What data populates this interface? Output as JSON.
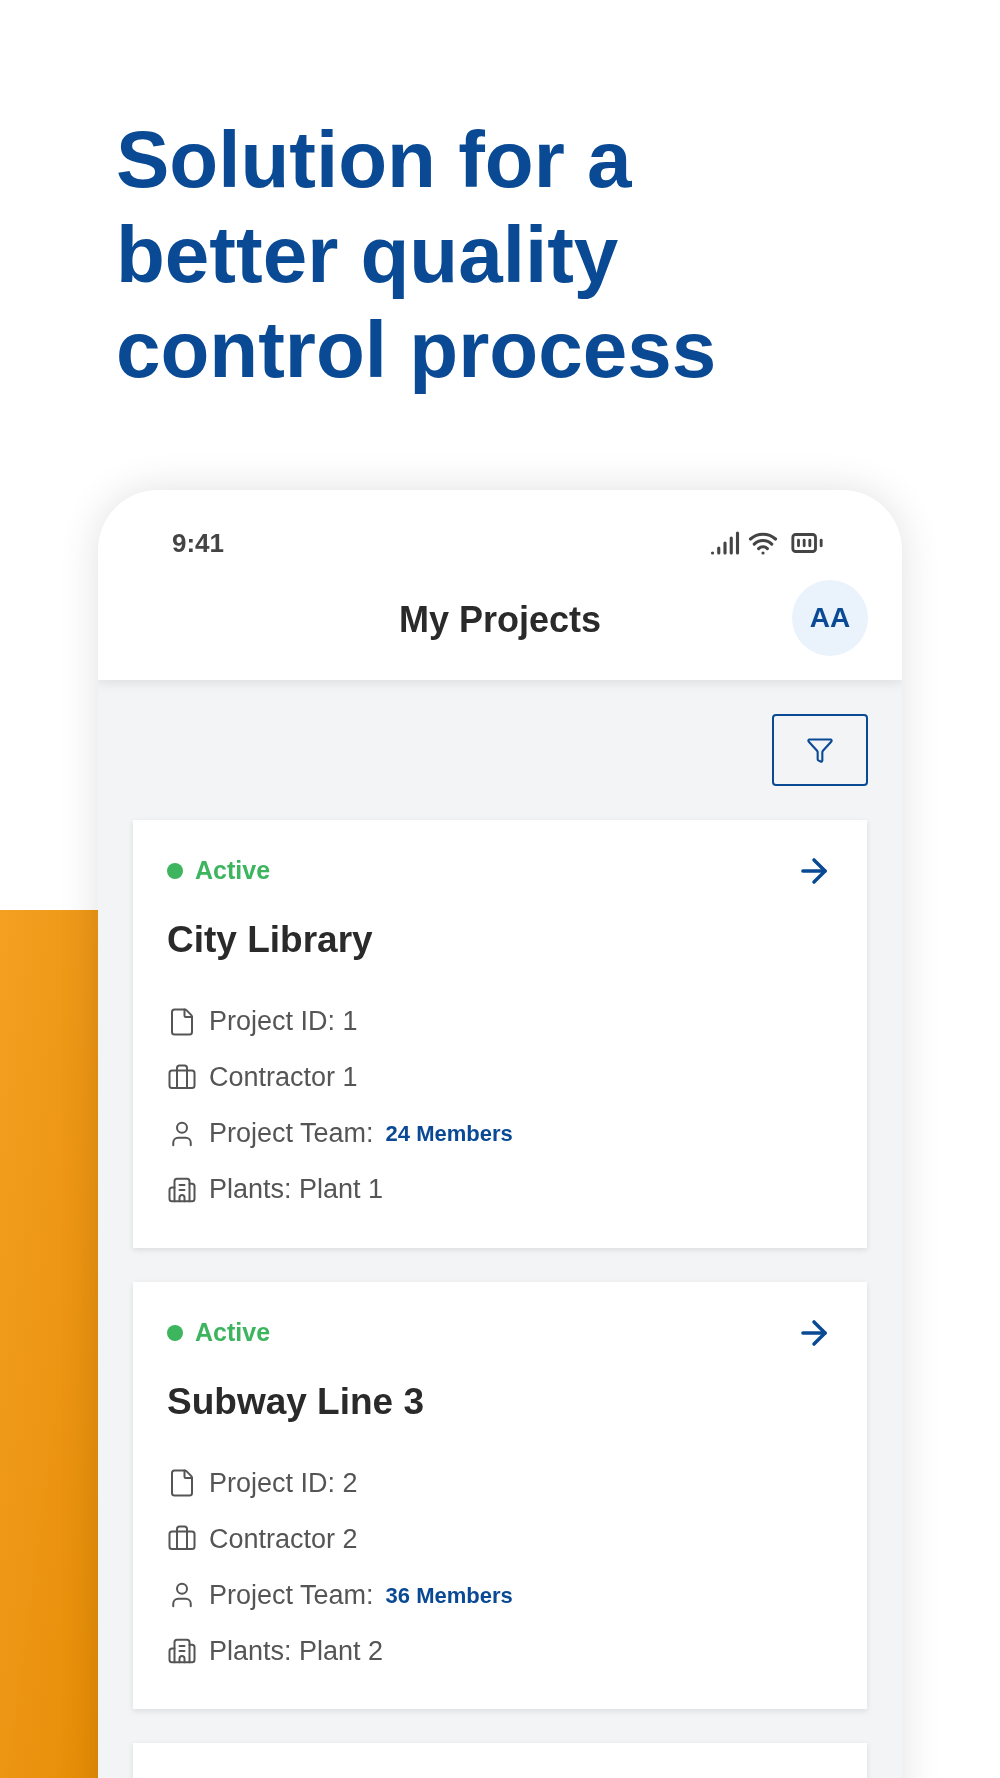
{
  "headline_lines": [
    "Solution for a",
    "better quality",
    "control process"
  ],
  "status_bar": {
    "time": "9:41"
  },
  "header": {
    "title": "My Projects",
    "avatar": "AA"
  },
  "projects": [
    {
      "status": "Active",
      "color": "#3cb55e",
      "name": "City Library",
      "project_id": "Project ID: 1",
      "contractor": "Contractor 1",
      "team_label": "Project Team:",
      "team_count": "24 Members",
      "plants": "Plants: Plant 1"
    },
    {
      "status": "Active",
      "color": "#3cb55e",
      "name": "Subway Line 3",
      "project_id": "Project ID: 2",
      "contractor": "Contractor 2",
      "team_label": "Project Team:",
      "team_count": "36 Members",
      "plants": "Plants: Plant 2"
    }
  ]
}
